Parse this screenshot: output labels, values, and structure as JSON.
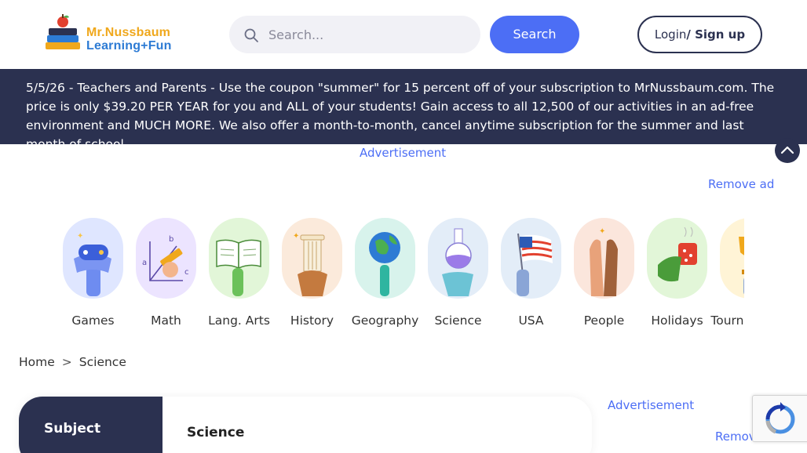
{
  "header": {
    "logo_line1": "Mr.Nussbaum",
    "logo_line2": "Learning+Fun",
    "search_placeholder": "Search...",
    "search_button": "Search",
    "login_label": "Login",
    "signup_label": "/ Sign up"
  },
  "banner": {
    "text": "5/5/26 - Teachers and Parents - Use the coupon \"summer\" for 15 percent off of your subscription to MrNussbaum.com. The price is only $39.20 PER YEAR for you and ALL of your students! Gain access to all 12,500 of our activities in an ad-free environment and MUCH MORE. We also offer a month-to-month, cancel anytime subscription for the summer and last month of school."
  },
  "ads": {
    "label": "Advertisement",
    "remove": "Remove ad",
    "label2": "Advertisement",
    "remove2": "Remove ad"
  },
  "categories": [
    {
      "label": "Games",
      "icon": "game-controller-icon",
      "color": "#dfe6ff"
    },
    {
      "label": "Math",
      "icon": "pencil-math-icon",
      "color": "#ece4ff"
    },
    {
      "label": "Lang. Arts",
      "icon": "open-book-icon",
      "color": "#e2f6d8"
    },
    {
      "label": "History",
      "icon": "column-icon",
      "color": "#fbeadb"
    },
    {
      "label": "Geography",
      "icon": "globe-icon",
      "color": "#d8f3ec"
    },
    {
      "label": "Science",
      "icon": "flask-icon",
      "color": "#e3edf8"
    },
    {
      "label": "USA",
      "icon": "us-flag-icon",
      "color": "#e3edf8"
    },
    {
      "label": "People",
      "icon": "high-five-icon",
      "color": "#fbe6dc"
    },
    {
      "label": "Holidays",
      "icon": "mug-icon",
      "color": "#e2f6d8"
    },
    {
      "label": "Tournaments",
      "icon": "trophy-icon",
      "color": "#fff4d6"
    }
  ],
  "breadcrumb": {
    "home": "Home",
    "separator": ">",
    "current": "Science"
  },
  "subject_panel": {
    "side_label": "Subject",
    "title": "Science"
  },
  "colors": {
    "navy": "#2b3150",
    "accent": "#4c6ef5"
  }
}
